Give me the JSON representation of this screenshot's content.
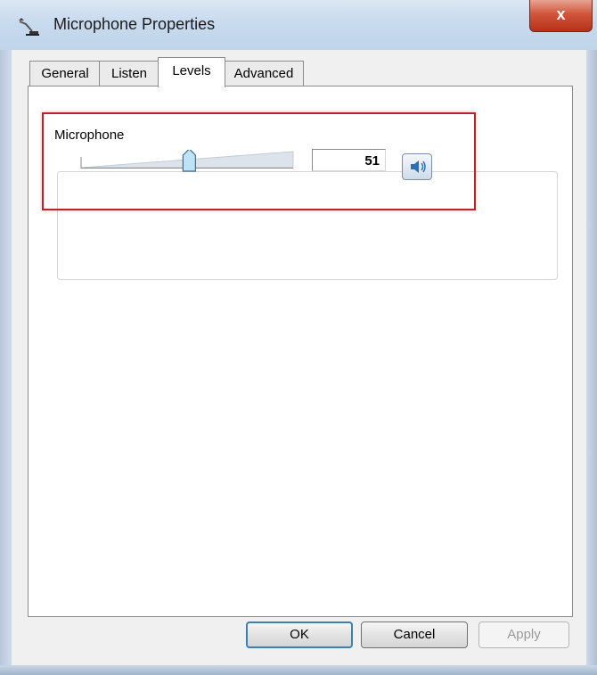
{
  "window": {
    "title": "Microphone Properties",
    "icon": "microphone-icon",
    "close_label": "x"
  },
  "tabs": [
    {
      "label": "General"
    },
    {
      "label": "Listen"
    },
    {
      "label": "Levels",
      "active": true
    },
    {
      "label": "Advanced"
    }
  ],
  "levels": {
    "group_label": "Microphone",
    "slider_value_percent": 51,
    "value_text": "51",
    "mute_icon": "speaker-icon"
  },
  "buttons": {
    "ok": "OK",
    "cancel": "Cancel",
    "apply": "Apply"
  },
  "colors": {
    "highlight_border": "#b3262b",
    "default_button_border": "#3c7fb1"
  }
}
